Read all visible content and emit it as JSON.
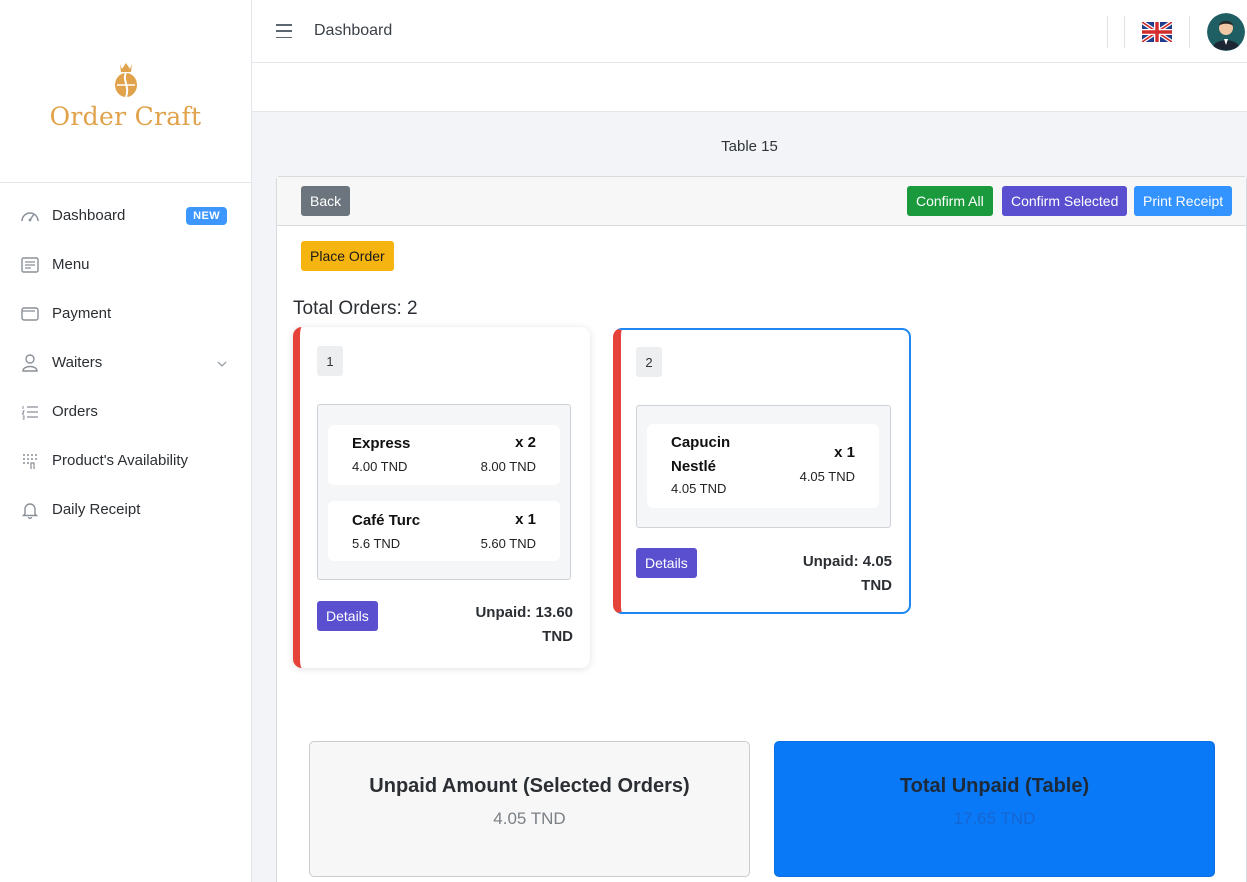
{
  "brand": {
    "name": "Order Craft"
  },
  "sidebar": {
    "items": [
      {
        "label": "Dashboard",
        "icon": "dashboard-gauge-icon",
        "badge": "NEW"
      },
      {
        "label": "Menu",
        "icon": "menu-list-icon"
      },
      {
        "label": "Payment",
        "icon": "wallet-icon"
      },
      {
        "label": "Waiters",
        "icon": "user-icon"
      },
      {
        "label": "Orders",
        "icon": "ordered-list-icon"
      },
      {
        "label": "Product's Availability",
        "icon": "availability-icon"
      },
      {
        "label": "Daily Receipt",
        "icon": "bell-icon"
      }
    ]
  },
  "topbar": {
    "title": "Dashboard",
    "language": "English (UK flag)"
  },
  "page": {
    "table_title": "Table 15",
    "buttons": {
      "back": "Back",
      "confirm_all": "Confirm All",
      "confirm_selected": "Confirm Selected",
      "print_receipt": "Print Receipt",
      "place_order": "Place Order"
    },
    "total_orders": "Total Orders: 2",
    "orders": [
      {
        "number": "1",
        "items": [
          {
            "name": "Express",
            "qty": "x 2",
            "price": "4.00 TND",
            "total": "8.00 TND"
          },
          {
            "name": "Café Turc",
            "qty": "x 1",
            "price": "5.6 TND",
            "total": "5.60 TND"
          }
        ],
        "details_label": "Details",
        "unpaid_line1": "Unpaid: 13.60",
        "unpaid_line2": "TND"
      },
      {
        "number": "2",
        "items": [
          {
            "name_line1": "Capucin",
            "name_line2": "Nestlé",
            "qty": "x 1",
            "price": "4.05 TND",
            "total": "4.05 TND"
          }
        ],
        "details_label": "Details",
        "unpaid_line1": "Unpaid: 4.05",
        "unpaid_line2": "TND"
      }
    ],
    "summary": {
      "selected_title": "Unpaid Amount (Selected Orders)",
      "selected_value": "4.05 TND",
      "table_title": "Total Unpaid (Table)",
      "table_value": "17.65 TND"
    }
  },
  "colors": {
    "accent": "#3e97ff",
    "brand": "#e0a24a",
    "confirm_all": "#1a9a3c",
    "confirm_selected": "#5a4fcf",
    "print": "#3393ff",
    "place_order": "#f5b40f",
    "order_border": "#e5423a",
    "selected_border": "#1e88f0",
    "total_card": "#0a79f7"
  }
}
